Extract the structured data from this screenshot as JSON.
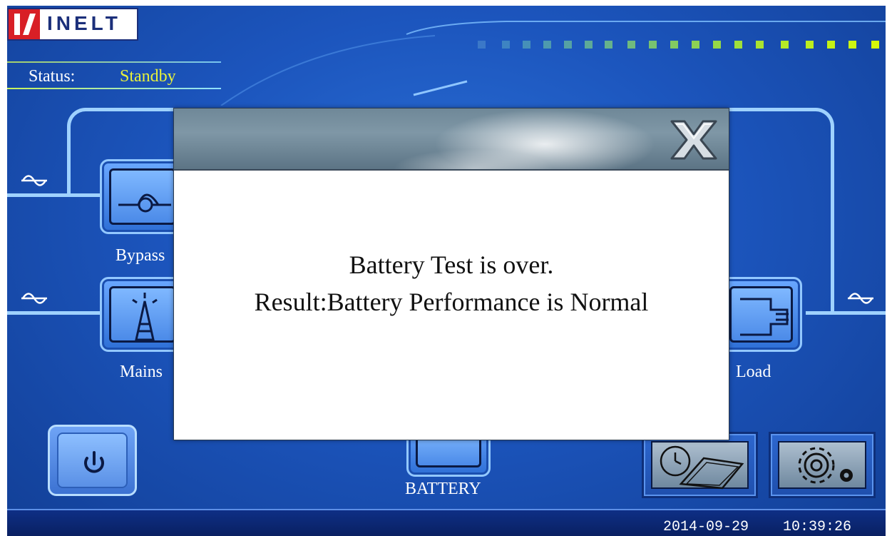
{
  "app": {
    "brand": "INELT"
  },
  "status": {
    "label": "Status:",
    "value": "Standby"
  },
  "components": {
    "bypass": {
      "label": "Bypass"
    },
    "mains": {
      "label": "Mains"
    },
    "load": {
      "label": "Load"
    },
    "battery": {
      "label": "BATTERY"
    }
  },
  "footer": {
    "date": "2014-09-29",
    "time": "10:39:26"
  },
  "dialog": {
    "message_line1": "Battery Test is over.",
    "message_line2": "Result:Battery Performance is Normal"
  },
  "icons": {
    "power": "power-icon",
    "history": "clock-log-icon",
    "settings": "gears-icon",
    "close": "close-x-icon",
    "ac": "sine-wave-icon"
  },
  "colors": {
    "background": "#1c55bd",
    "status_value": "#e8f23a",
    "text": "#ffffff",
    "dialog_text": "#111111"
  }
}
